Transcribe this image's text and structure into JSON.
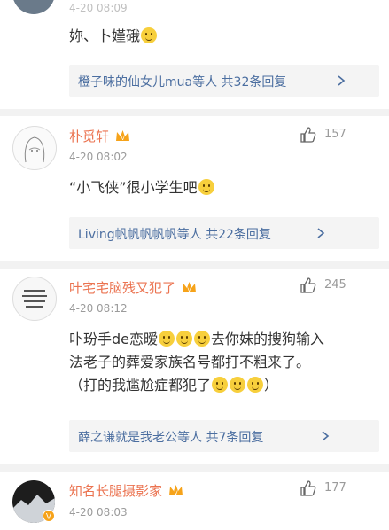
{
  "comments": [
    {
      "time": "4-20 08:09",
      "content": "妳、卜嫤硪",
      "reply_summary": "橙子味的仙女儿mua等人 共32条回复",
      "chevron": ">"
    },
    {
      "name": "朴觅轩",
      "time": "4-20 08:02",
      "likes": "157",
      "content": "“小飞侠”很小学生吧",
      "reply_summary": "Living帆帆帆帆帆等人 共22条回复",
      "chevron": ">"
    },
    {
      "name": "叶宅宅脑残又犯了",
      "time": "4-20 08:12",
      "likes": "245",
      "content_line1": "卟玢手de恋暧",
      "content_line1b": "去你妹的搜狗输入",
      "content_line2": "法老子的葬爱家族名号都打不粗来了。",
      "content_line3": "（打的我尴尬症都犯了",
      "content_line3_end": "）",
      "reply_summary": "薛之谦就是我老公等人 共7条回复",
      "chevron": ">"
    },
    {
      "name": "知名长腿摄影家",
      "time": "4-20 08:03",
      "likes": "177"
    }
  ],
  "icons": [
    "like-icon",
    "crown-badge-icon",
    "chevron-right-icon",
    "emoji-icon",
    "verified-badge-icon"
  ],
  "colors": {
    "name": "#eb7350",
    "link": "#4b6ea0",
    "muted": "#9b9b9b",
    "reply_bg": "#f4f4f4"
  }
}
